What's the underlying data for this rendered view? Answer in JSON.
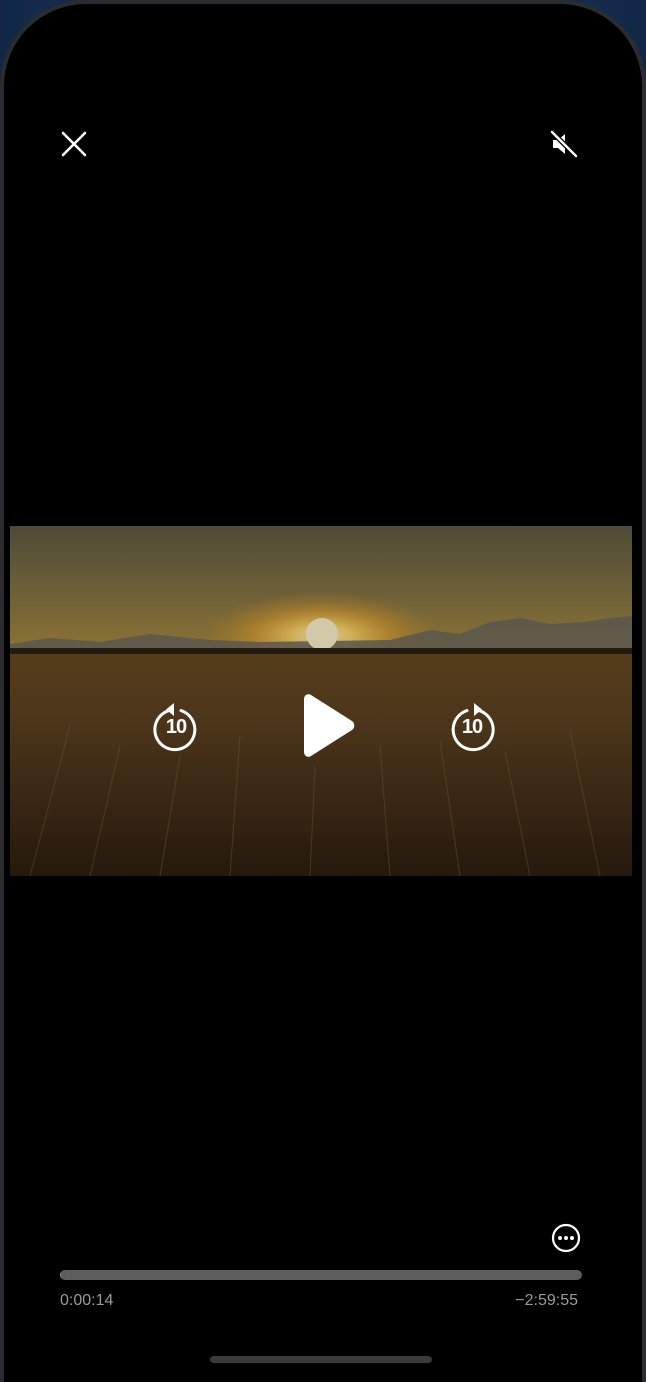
{
  "player": {
    "close_icon": "close-icon",
    "mute_icon": "speaker-muted-icon",
    "skip_back_icon": "skip-back-10-icon",
    "skip_back_label": "10",
    "play_icon": "play-icon",
    "skip_forward_icon": "skip-forward-10-icon",
    "skip_forward_label": "10",
    "more_icon": "more-options-icon",
    "elapsed_time": "0:00:14",
    "remaining_time": "−2:59:55",
    "progress": 0.0013
  },
  "colors": {
    "background": "#000000",
    "controls": "#ffffff",
    "track": "#5d5d5f",
    "time_text": "#9a9a9c"
  }
}
